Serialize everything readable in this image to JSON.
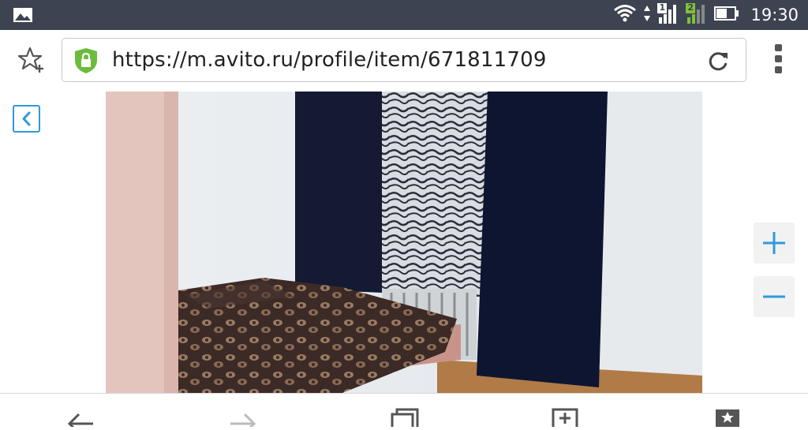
{
  "status_bar": {
    "gallery_icon": "image-icon",
    "wifi_icon": "wifi-icon",
    "sim1_label": "1",
    "sim2_label": "2",
    "battery_icon": "battery-icon",
    "time": "19:30"
  },
  "toolbar": {
    "bookmark_add_icon": "star-plus-icon",
    "secure_icon": "lock-shield-icon",
    "url": "https://m.avito.ru/profile/item/671811709",
    "reload_icon": "reload-icon",
    "menu_icon": "more-vertical-icon"
  },
  "content": {
    "back_icon": "chevron-left-icon",
    "photo_subject": "bedroom-photo",
    "zoom_in_icon": "plus-icon",
    "zoom_out_icon": "minus-icon"
  },
  "bottom_nav": {
    "items": [
      "back-arrow-icon",
      "forward-arrow-icon",
      "tabs-icon",
      "save-page-icon",
      "bookmarks-icon"
    ]
  },
  "colors": {
    "status_bar": "#3d4350",
    "accent": "#2f9bd9",
    "lock_green": "#6cbb3c"
  }
}
